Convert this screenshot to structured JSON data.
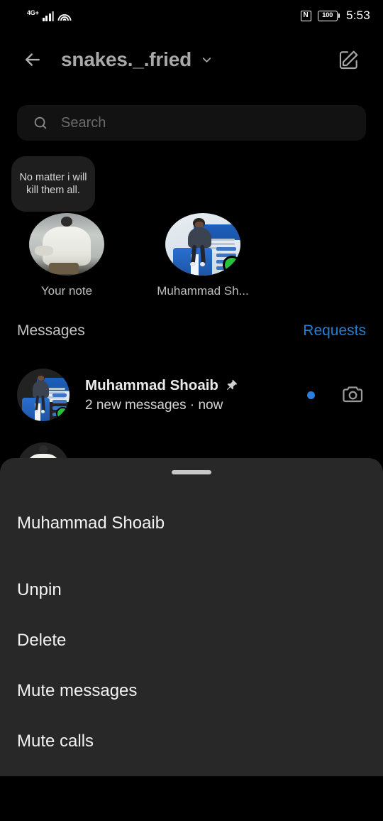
{
  "status_bar": {
    "network_label": "4G+",
    "nfc_icon": "nfc-icon",
    "battery_level": "100",
    "time": "5:53"
  },
  "header": {
    "back_icon": "back-arrow-icon",
    "account_name": "snakes._.fried",
    "chevron_icon": "chevron-down-icon",
    "compose_icon": "compose-icon"
  },
  "search": {
    "icon": "search-icon",
    "placeholder": "Search",
    "value": ""
  },
  "notes": [
    {
      "bubble_text": "No matter i will kill them all.",
      "label": "Your note",
      "avatar": "your-note-avatar",
      "online": false
    },
    {
      "bubble_text": "",
      "label": "Muhammad Sh...",
      "avatar": "muhammad-shoaib-avatar",
      "online": true
    }
  ],
  "messages_section": {
    "title": "Messages",
    "requests_label": "Requests",
    "requests_color": "#1f7fd6"
  },
  "chats": [
    {
      "name": "Muhammad Shoaib",
      "pinned": true,
      "pin_icon": "pin-icon",
      "preview": "2 new messages",
      "separator": "·",
      "timestamp": "now",
      "unread": true,
      "unread_color": "#2a7ede",
      "camera_icon": "camera-icon",
      "online": true
    },
    {
      "name": "",
      "pinned": false,
      "preview": "",
      "timestamp": "",
      "unread": false,
      "online": false
    }
  ],
  "bottom_sheet": {
    "handle": "drag-handle",
    "title": "Muhammad Shoaib",
    "items": [
      {
        "label": "Unpin"
      },
      {
        "label": "Delete"
      },
      {
        "label": "Mute messages"
      },
      {
        "label": "Mute calls"
      }
    ]
  },
  "colors": {
    "background": "#000000",
    "sheet": "#282828",
    "accent_blue": "#1f7fd6",
    "online_green": "#28c13a"
  }
}
